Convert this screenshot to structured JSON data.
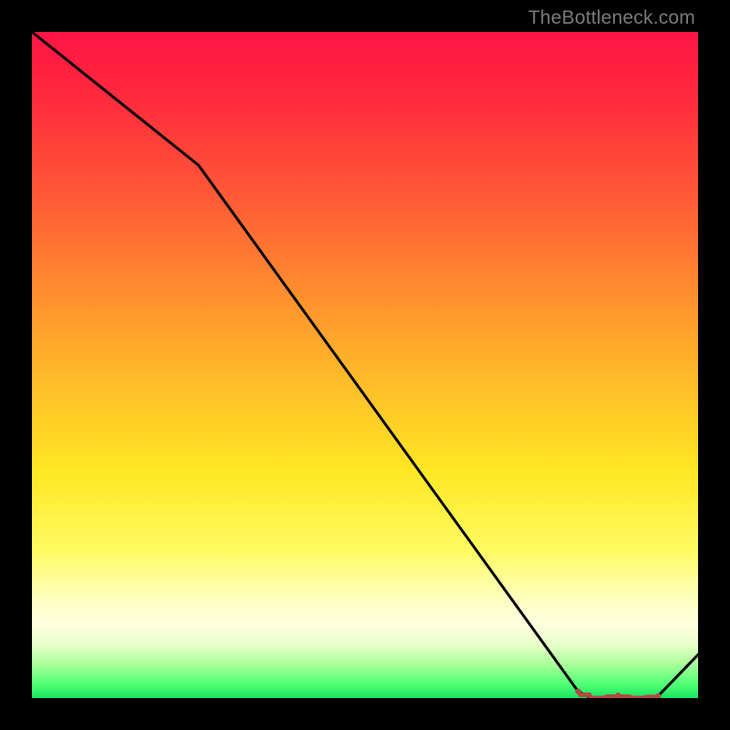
{
  "attribution": "TheBottleneck.com",
  "chart_data": {
    "type": "line",
    "title": "",
    "xlabel": "",
    "ylabel": "",
    "xlim": [
      0,
      100
    ],
    "ylim": [
      0,
      100
    ],
    "x": [
      0,
      25,
      82,
      84,
      86,
      88,
      90,
      92,
      94,
      100
    ],
    "values": [
      100,
      80,
      1,
      0,
      0,
      0.4,
      0,
      0,
      0.3,
      6.5
    ],
    "dotted_segment": {
      "x": [
        82,
        84,
        86,
        88,
        90,
        92,
        94
      ],
      "values": [
        1,
        0,
        0,
        0.4,
        0,
        0,
        0.3
      ]
    },
    "colors": {
      "line": "#000000",
      "dotted": "#b24a43"
    }
  }
}
